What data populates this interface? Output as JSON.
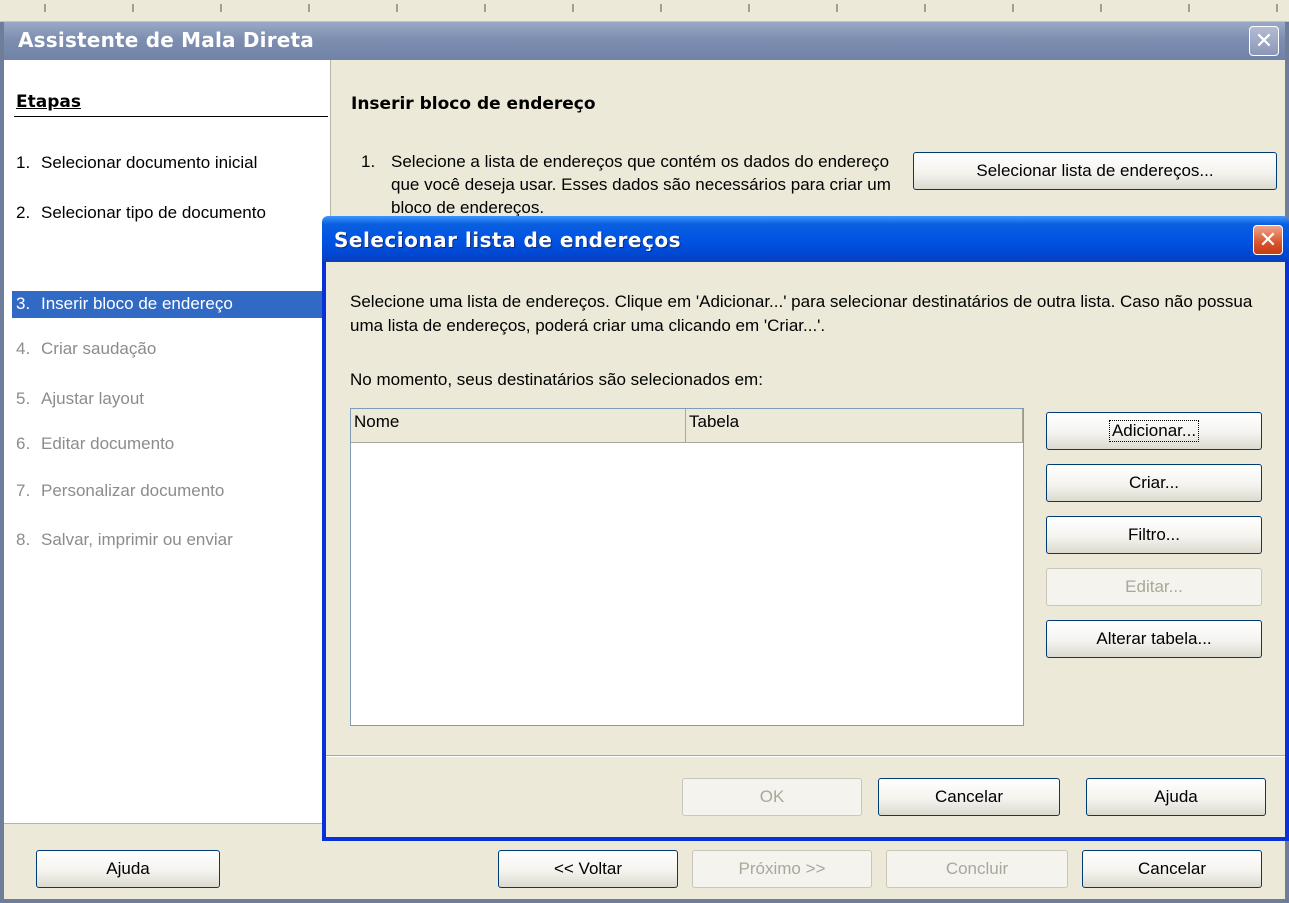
{
  "main_window": {
    "title": "Assistente de Mala Direta"
  },
  "steps": {
    "heading": "Etapas",
    "items": [
      {
        "num": "1.",
        "label": "Selecionar documento inicial",
        "state": "done"
      },
      {
        "num": "2.",
        "label": "Selecionar tipo de documento",
        "state": "done"
      },
      {
        "num": "3.",
        "label": "Inserir bloco de endereço",
        "state": "active"
      },
      {
        "num": "4.",
        "label": "Criar saudação",
        "state": "disabled"
      },
      {
        "num": "5.",
        "label": "Ajustar layout",
        "state": "disabled"
      },
      {
        "num": "6.",
        "label": "Editar documento",
        "state": "disabled"
      },
      {
        "num": "7.",
        "label": "Personalizar documento",
        "state": "disabled"
      },
      {
        "num": "8.",
        "label": "Salvar, imprimir ou enviar",
        "state": "disabled"
      }
    ]
  },
  "content": {
    "section_title": "Inserir bloco de endereço",
    "instruction_num": "1.",
    "instruction_text": "Selecione a lista de endereços que contém os dados do endereço que você deseja usar. Esses dados são necessários para criar um bloco de endereços.",
    "select_list_button": "Selecionar lista de endereços..."
  },
  "bottom_bar": {
    "help": "Ajuda",
    "back": "<< Voltar",
    "next": "Próximo >>",
    "finish": "Concluir",
    "cancel": "Cancelar"
  },
  "dialog": {
    "title": "Selecionar lista de endereços",
    "description": "Selecione uma lista de endereços. Clique em 'Adicionar...' para selecionar destinatários de outra lista. Caso não possua uma lista de endereços, poderá criar uma clicando em 'Criar...'.",
    "current_label": "No momento, seus destinatários são selecionados em:",
    "columns": [
      "Nome",
      "Tabela"
    ],
    "rows": [],
    "buttons": {
      "add": "Adicionar...",
      "create": "Criar...",
      "filter": "Filtro...",
      "edit": "Editar...",
      "change_table": "Alterar tabela...",
      "ok": "OK",
      "cancel": "Cancelar",
      "help": "Ajuda"
    }
  },
  "colors": {
    "dialog_title": "#0054e3",
    "active_step": "#316ac5",
    "disabled_text": "#8c8c8c",
    "window_bg": "#ece9d8"
  },
  "icons": {
    "close": "close-icon"
  }
}
